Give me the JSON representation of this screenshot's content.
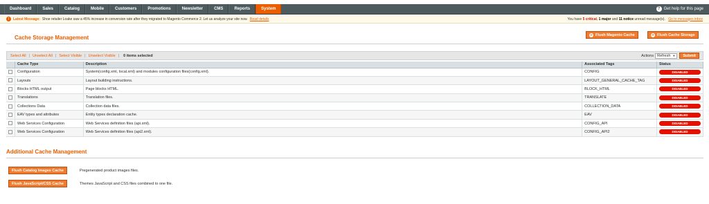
{
  "nav": {
    "items": [
      "Dashboard",
      "Sales",
      "Catalog",
      "Mobile",
      "Customers",
      "Promotions",
      "Newsletter",
      "CMS",
      "Reports",
      "System"
    ],
    "active": "System",
    "help_label": "Get help for this page"
  },
  "notice": {
    "label": "Latest Message:",
    "text": "Shoe retailer Loake saw a 45% increase in conversion rate after they migrated to Magento Commerce 2. Let us analyze your site now.",
    "link": "Read details",
    "summary_prefix": "You have",
    "critical_count": "5 critical",
    "major": "1 major",
    "and": "and",
    "notice_count": "11 notice",
    "summary_suffix": "unread message(s).",
    "inbox_link": "Go to messages inbox"
  },
  "page": {
    "title": "Cache Storage Management",
    "flush_magento_label": "Flush Magento Cache",
    "flush_storage_label": "Flush Cache Storage"
  },
  "massaction": {
    "select_all": "Select All",
    "unselect_all": "Unselect All",
    "select_visible": "Select Visible",
    "unselect_visible": "Unselect Visible",
    "selected_count": "0 items selected",
    "actions_label": "Actions",
    "action_value": "Refresh",
    "submit_label": "Submit"
  },
  "grid": {
    "columns": [
      "Cache Type",
      "Description",
      "Associated Tags",
      "Status"
    ],
    "rows": [
      {
        "type": "Configuration",
        "description": "System(config.xml, local.xml) and modules configuration files(config.xml).",
        "tags": "CONFIG",
        "status": "DISABLED"
      },
      {
        "type": "Layouts",
        "description": "Layout building instructions.",
        "tags": "LAYOUT_GENERAL_CACHE_TAG",
        "status": "DISABLED"
      },
      {
        "type": "Blocks HTML output",
        "description": "Page blocks HTML.",
        "tags": "BLOCK_HTML",
        "status": "DISABLED"
      },
      {
        "type": "Translations",
        "description": "Translation files.",
        "tags": "TRANSLATE",
        "status": "DISABLED"
      },
      {
        "type": "Collections Data",
        "description": "Collection data files.",
        "tags": "COLLECTION_DATA",
        "status": "DISABLED"
      },
      {
        "type": "EAV types and attributes",
        "description": "Entity types declaration cache.",
        "tags": "EAV",
        "status": "DISABLED"
      },
      {
        "type": "Web Services Configuration",
        "description": "Web Services definition files (api.xml).",
        "tags": "CONFIG_API",
        "status": "DISABLED"
      },
      {
        "type": "Web Services Configuration",
        "description": "Web Services definition files (api2.xml).",
        "tags": "CONFIG_API2",
        "status": "DISABLED"
      }
    ]
  },
  "additional": {
    "title": "Additional Cache Management",
    "catalog_images_label": "Flush Catalog Images Cache",
    "catalog_images_desc": "Pregenerated product images files.",
    "js_css_label": "Flush JavaScript/CSS Cache",
    "js_css_desc": "Themes JavaScript and CSS files combined to one file."
  },
  "colors": {
    "accent": "#eb5e00",
    "nav_bg": "#4d5a5e",
    "status_disabled": "#e41101"
  }
}
